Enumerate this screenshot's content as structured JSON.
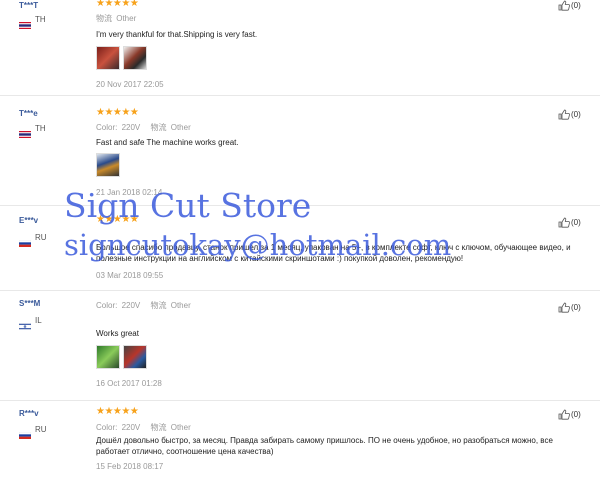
{
  "reviews": [
    {
      "user": "T***T",
      "country": "TH",
      "stars": "★★★★★",
      "color_label": "",
      "color_value": "",
      "ship_label": "物流",
      "ship_value": "Other",
      "comment": "I'm very thankful for that.Shipping is very fast.",
      "date": "20 Nov 2017 22:05",
      "likes": "(0)"
    },
    {
      "user": "T***e",
      "country": "TH",
      "stars": "★★★★★",
      "color_label": "Color:",
      "color_value": "220V",
      "ship_label": "物流",
      "ship_value": "Other",
      "comment": "Fast and safe The machine works great.",
      "date": "21 Jan 2018 02:14",
      "likes": "(0)"
    },
    {
      "user": "E***v",
      "country": "RU",
      "stars": "★★★★★",
      "color_label": "",
      "color_value": "",
      "ship_label": "",
      "ship_value": "",
      "comment": "Большое спасибо продавцу, станок пришел за 1 месяц, упакован на 5+, в комплекте софт, ключ с ключом, обучающее видео, и полезные инструкции на английском с китайскими скриншотами :) покупкой доволен, рекомендую!",
      "date": "03 Mar 2018 09:55",
      "likes": "(0)"
    },
    {
      "user": "S***M",
      "country": "IL",
      "stars": "",
      "color_label": "Color:",
      "color_value": "220V",
      "ship_label": "物流",
      "ship_value": "Other",
      "comment": "Works great",
      "date": "16 Oct 2017 01:28",
      "likes": "(0)"
    },
    {
      "user": "R***v",
      "country": "RU",
      "stars": "★★★★★",
      "color_label": "Color:",
      "color_value": "220V",
      "ship_label": "物流",
      "ship_value": "Other",
      "comment": "Дошёл довольно быстро, за месяц. Правда забирать самому пришлось. ПО не очень удобное, но разобраться можно, все работает отлично, соотношение цена качества)",
      "date": "15 Feb 2018 08:17",
      "likes": "(0)"
    }
  ],
  "watermark": {
    "line1": "Sign Cut Store",
    "line2": "signcutokay@hotmail.com"
  },
  "colors": {
    "star": "#f7a21b",
    "user": "#3a5a9a",
    "watermark": "#3b5bdc"
  }
}
